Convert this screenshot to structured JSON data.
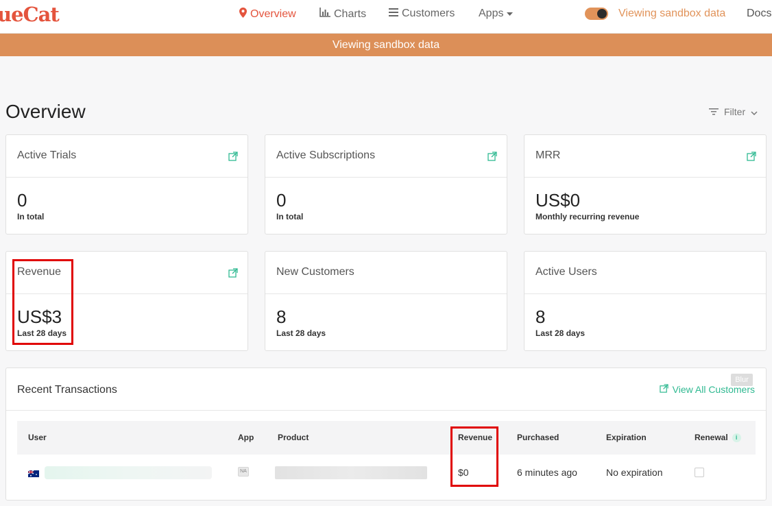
{
  "nav": {
    "logo": "ueCat",
    "items": [
      {
        "label": "Overview",
        "icon": "map-pin-icon",
        "active": true
      },
      {
        "label": "Charts",
        "icon": "bar-chart-icon"
      },
      {
        "label": "Customers",
        "icon": "list-icon"
      },
      {
        "label": "Apps",
        "icon": "caret-down-icon"
      }
    ],
    "sandbox_link": "Viewing sandbox data",
    "docs": "Docs"
  },
  "banner": "Viewing sandbox data",
  "page": {
    "title": "Overview",
    "filter_label": "Filter"
  },
  "cards": [
    {
      "title": "Active Trials",
      "value": "0",
      "sub": "In total",
      "external_link": true
    },
    {
      "title": "Active Subscriptions",
      "value": "0",
      "sub": "In total",
      "external_link": true
    },
    {
      "title": "MRR",
      "value": "US$0",
      "sub": "Monthly recurring revenue",
      "external_link": true
    },
    {
      "title": "Revenue",
      "value": "US$3",
      "sub": "Last 28 days",
      "external_link": true
    },
    {
      "title": "New Customers",
      "value": "8",
      "sub": "Last 28 days",
      "external_link": false
    },
    {
      "title": "Active Users",
      "value": "8",
      "sub": "Last 28 days",
      "external_link": false
    }
  ],
  "transactions": {
    "title": "Recent Transactions",
    "view_all": "View All Customers",
    "blur_button": "Blur",
    "columns": [
      "User",
      "App",
      "Product",
      "Revenue",
      "Purchased",
      "Expiration",
      "Renewal"
    ],
    "rows": [
      {
        "app_badge": "NA",
        "revenue": "$0",
        "purchased": "6 minutes ago",
        "expiration": "No expiration"
      }
    ]
  },
  "colors": {
    "brand": "#e4543d",
    "sandbox": "#dc8f58",
    "accent": "#2fb991",
    "highlight": "#e00000"
  }
}
